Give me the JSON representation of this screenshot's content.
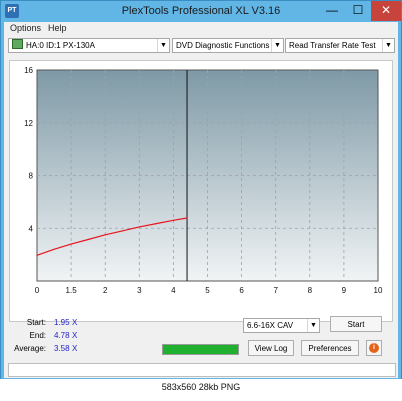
{
  "window": {
    "title": "PlexTools Professional XL V3.16",
    "minimize": "—",
    "maximize": "☐",
    "close": "✕",
    "app_icon": "PT"
  },
  "menu": {
    "items": [
      "Options",
      "Help"
    ]
  },
  "toolbar": {
    "drive": "HA:0 ID:1   PX-130A",
    "function": "DVD Diagnostic Functions",
    "test": "Read Transfer Rate Test"
  },
  "chart_data": {
    "type": "line",
    "xlim": [
      0,
      10
    ],
    "ylim": [
      0,
      16
    ],
    "x_ticks": [
      "0",
      "1.5",
      "2",
      "3",
      "4",
      "5",
      "6",
      "7",
      "8",
      "9",
      "10"
    ],
    "y_ticks": [
      "16",
      "12",
      "8",
      "4"
    ],
    "grid": true,
    "series": [
      {
        "color": "#e8141e",
        "x": [
          0.0,
          0.5,
          1.0,
          1.5,
          2.0,
          2.5,
          3.0,
          3.5,
          4.0,
          4.4
        ],
        "y": [
          1.95,
          2.4,
          2.8,
          3.15,
          3.5,
          3.8,
          4.1,
          4.35,
          4.6,
          4.78
        ]
      }
    ],
    "progress_marker_x": 4.4,
    "background_top": "#7e99a6",
    "background_bottom": "#f1f4f5"
  },
  "stats": {
    "start_label": "Start:",
    "start_value": "1.95",
    "end_label": "End:",
    "end_value": "4.78",
    "average_label": "Average:",
    "average_value": "3.58",
    "unit_mark": "X"
  },
  "controls": {
    "speed": "6.6-16X CAV",
    "start_button": "Start",
    "view_log_button": "View Log",
    "preferences_button": "Preferences",
    "info_icon": "i",
    "progress_percent": 100
  },
  "caption": "583x560  28kb  PNG"
}
